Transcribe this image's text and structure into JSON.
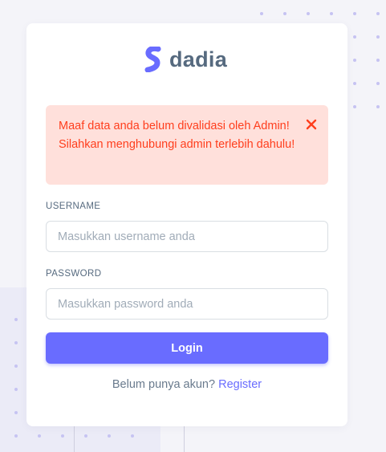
{
  "brand": {
    "name": "dadia",
    "accent_color": "#696cff",
    "logo_icon": "s-logo-icon"
  },
  "alert": {
    "message": "Maaf data anda belum divalidasi oleh Admin! Silahkan menghubungi admin terlebih dahulu!",
    "close_icon": "close-icon",
    "color": "#ff3e1d",
    "background": "#ffe0db"
  },
  "form": {
    "username_label": "USERNAME",
    "username_placeholder": "Masukkan username anda",
    "username_value": "",
    "password_label": "PASSWORD",
    "password_placeholder": "Masukkan password anda",
    "password_value": "",
    "login_label": "Login"
  },
  "footer": {
    "prompt": "Belum punya akun?",
    "register_label": "Register"
  }
}
